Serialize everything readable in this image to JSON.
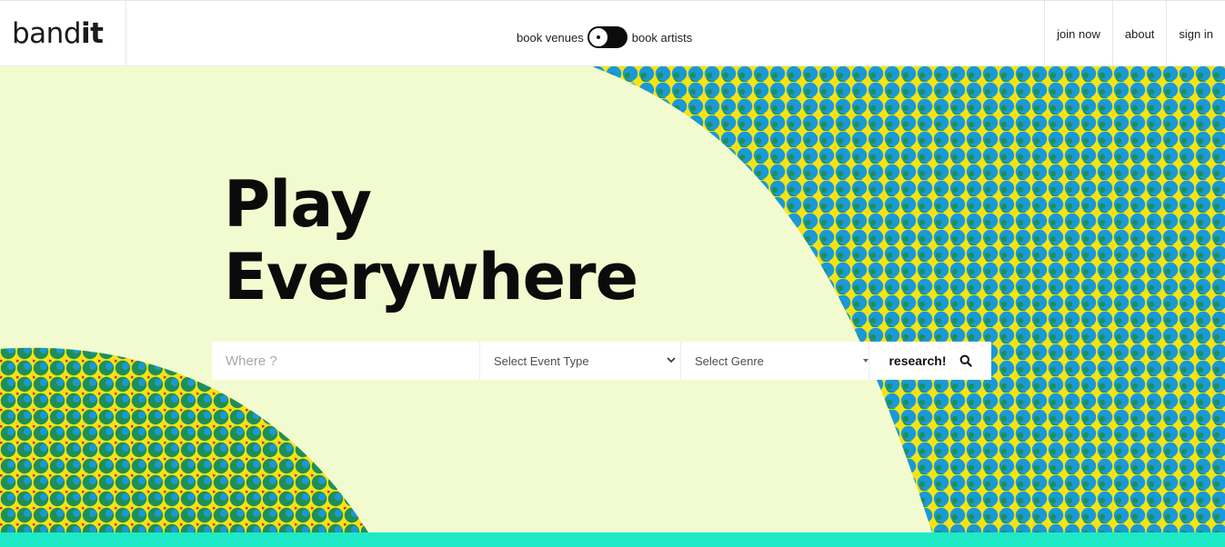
{
  "header": {
    "logo": {
      "light": "band",
      "bold": "it"
    },
    "toggle": {
      "left_label": "book venues",
      "right_label": "book artists"
    },
    "nav": [
      {
        "label": "join now"
      },
      {
        "label": "about"
      },
      {
        "label": "sign in"
      }
    ]
  },
  "hero": {
    "headline_line1": "Play",
    "headline_line2": "Everywhere"
  },
  "search": {
    "where_placeholder": "Where ?",
    "event_type_selected": "Select Event Type",
    "genre_selected": "Select Genre",
    "button_label": "research!",
    "button_icon": "search-icon"
  },
  "colors": {
    "background": "#f2fbcf",
    "pattern_blue": "#1a99d8",
    "pattern_green": "#1f8f57",
    "pattern_yellow": "#f5e414",
    "pattern_red": "#e0223a",
    "footer_strip": "#1de9c7"
  }
}
